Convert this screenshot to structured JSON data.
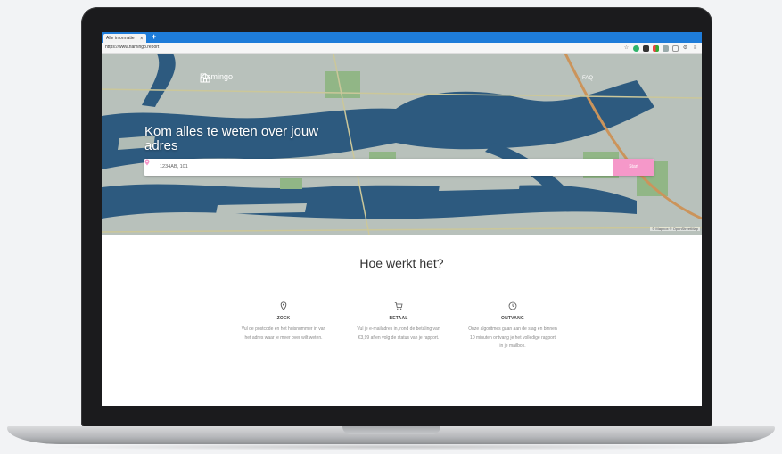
{
  "browser": {
    "tab_title": "Alle informatie",
    "tab_close": "×",
    "new_tab": "+",
    "url": "https://www.flamingo.report"
  },
  "colors": {
    "accent_pink": "#f598c9",
    "browser_blue": "#1e7cd9",
    "water": "#2f5f86"
  },
  "header": {
    "brand": "Flamingo",
    "brand_icon": "house-icon",
    "faq": "FAQ"
  },
  "hero": {
    "title": "Kom alles te weten over jouw adres",
    "search": {
      "value": "1234AB, 101",
      "icon": "location-pin-icon",
      "button": "Start"
    },
    "map_attribution": "© Mapbox © OpenStreetMap"
  },
  "how": {
    "title": "Hoe werkt het?",
    "steps": [
      {
        "icon": "map-pin-icon",
        "title": "ZOEK",
        "text": "Vul de postcode en het huisnummer in van het adres waar je meer over wilt weten."
      },
      {
        "icon": "cart-icon",
        "title": "BETAAL",
        "text": "Vul je e-mailadres in, rond de betaling van €3,99 af en volg de status van je rapport."
      },
      {
        "icon": "clock-icon",
        "title": "ONTVANG",
        "text": "Onze algoritmes gaan aan de slag en binnen 10 minuten ontvang je het volledige rapport in je mailbox."
      }
    ]
  }
}
